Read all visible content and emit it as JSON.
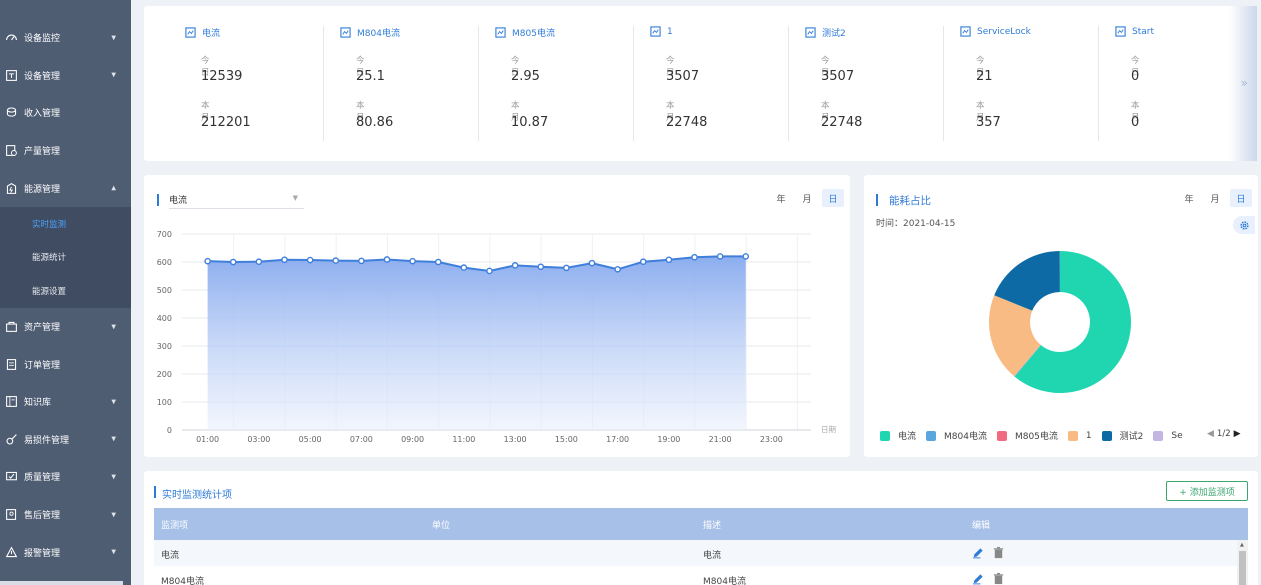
{
  "sidebar": {
    "items": [
      {
        "label": "设备监控",
        "icon": "dashboard-icon",
        "caret": "▼"
      },
      {
        "label": "设备管理",
        "icon": "device-icon",
        "caret": "▼"
      },
      {
        "label": "收入管理",
        "icon": "income-icon",
        "caret": ""
      },
      {
        "label": "产量管理",
        "icon": "output-icon",
        "caret": ""
      },
      {
        "label": "能源管理",
        "icon": "energy-icon",
        "caret": "▲"
      },
      {
        "label": "资产管理",
        "icon": "asset-icon",
        "caret": "▼"
      },
      {
        "label": "订单管理",
        "icon": "order-icon",
        "caret": ""
      },
      {
        "label": "知识库",
        "icon": "knowledge-icon",
        "caret": "▼"
      },
      {
        "label": "易损件管理",
        "icon": "parts-icon",
        "caret": "▼"
      },
      {
        "label": "质量管理",
        "icon": "quality-icon",
        "caret": "▼"
      },
      {
        "label": "售后管理",
        "icon": "aftersale-icon",
        "caret": "▼"
      },
      {
        "label": "报警管理",
        "icon": "alarm-icon",
        "caret": "▼"
      }
    ],
    "energy_sub": [
      "实时监测",
      "能源统计",
      "能源设置"
    ]
  },
  "stats": {
    "today_label": "今日",
    "month_label": "本月",
    "items": [
      {
        "name": "电流",
        "today": "12539",
        "month": "212201"
      },
      {
        "name": "M804电流",
        "today": "25.1",
        "month": "80.86"
      },
      {
        "name": "M805电流",
        "today": "2.95",
        "month": "10.87"
      },
      {
        "name": "1",
        "today": "3507",
        "month": "22748"
      },
      {
        "name": "测试2",
        "today": "3507",
        "month": "22748"
      },
      {
        "name": "ServiceLock",
        "today": "21",
        "month": "357"
      },
      {
        "name": "Start",
        "today": "0",
        "month": "0"
      }
    ],
    "more_arrow": "»"
  },
  "periods": {
    "year": "年",
    "month": "月",
    "day": "日"
  },
  "line_chart": {
    "selected": "电流",
    "dropdown_caret": "▼",
    "xlabel": "日期"
  },
  "pie": {
    "title": "能耗占比",
    "date": "时间：2021-04-15",
    "pager": "1/2",
    "prev": "◀",
    "next": "▶"
  },
  "chart_data": [
    {
      "type": "area",
      "x_ticks": [
        "01:00",
        "03:00",
        "05:00",
        "07:00",
        "09:00",
        "11:00",
        "13:00",
        "15:00",
        "17:00",
        "19:00",
        "21:00",
        "23:00"
      ],
      "y_ticks": [
        0,
        100,
        200,
        300,
        400,
        500,
        600,
        700
      ],
      "ylim": [
        0,
        700
      ],
      "xlabel": "日期",
      "series": [
        {
          "x": [
            "01:00",
            "02:00",
            "03:00",
            "04:00",
            "05:00",
            "06:00",
            "07:00",
            "08:00",
            "09:00",
            "10:00",
            "11:00",
            "12:00",
            "13:00",
            "14:00",
            "15:00",
            "16:00",
            "17:00",
            "18:00",
            "19:00",
            "20:00",
            "21:00",
            "22:00"
          ],
          "values": [
            603,
            600,
            601,
            608,
            607,
            605,
            604,
            609,
            603,
            600,
            580,
            568,
            588,
            583,
            579,
            596,
            574,
            601,
            608,
            617,
            620,
            620
          ],
          "color": "#3f7fdc"
        }
      ],
      "grid": true
    },
    {
      "type": "pie",
      "donut": true,
      "series_names": [
        "电流",
        "M804电流",
        "M805电流",
        "1",
        "测试2",
        "Se"
      ],
      "colors": [
        "#1fd6b0",
        "#5aa7e0",
        "#f26a7f",
        "#f9bb84",
        "#0d6aa4",
        "#c3b6e3"
      ],
      "values": [
        61,
        0.15,
        0.02,
        20,
        18.8,
        0.05
      ],
      "legend": "bottom"
    }
  ],
  "table": {
    "title": "实时监测统计项",
    "add_button": "+ 添加监测项",
    "headers": [
      "监测项",
      "单位",
      "描述",
      "编辑"
    ],
    "rows": [
      {
        "item": "电流",
        "unit": "",
        "desc": "电流"
      },
      {
        "item": "M804电流",
        "unit": "",
        "desc": "M804电流"
      }
    ]
  }
}
